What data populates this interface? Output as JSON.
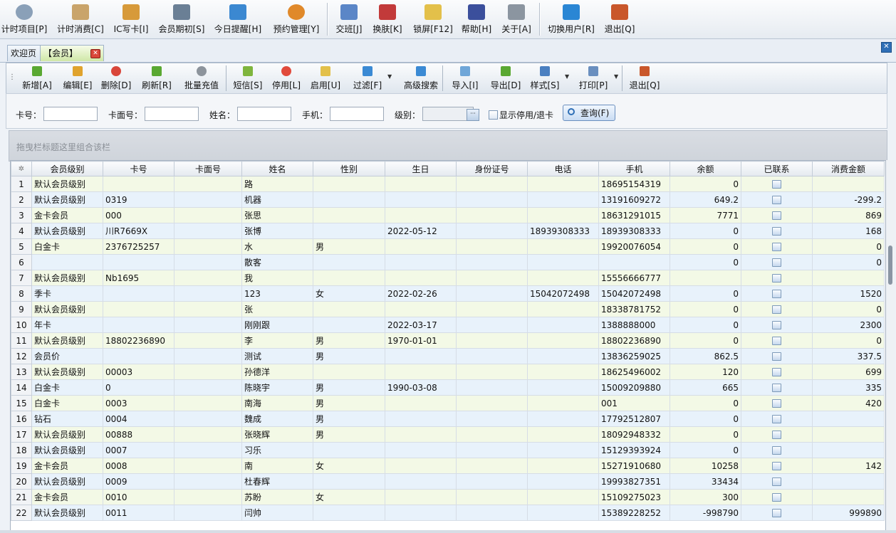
{
  "top_toolbar": [
    {
      "label": "计时项目[P]",
      "icon": "clock-icon",
      "color": "#8aa0b8"
    },
    {
      "label": "计时消费[C]",
      "icon": "hourglass-icon",
      "color": "#c9a46b"
    },
    {
      "label": "IC写卡[I]",
      "icon": "chip-card-icon",
      "color": "#d79a3a"
    },
    {
      "label": "会员期初[S]",
      "icon": "start-doc-icon",
      "color": "#6a7f95"
    },
    {
      "label": "今日提醒[H]",
      "icon": "reminder-icon",
      "color": "#3b88d1"
    },
    {
      "label": "预约管理[Y]",
      "icon": "schedule-icon",
      "color": "#e0892a"
    },
    {
      "label": "交班[J]",
      "icon": "handover-icon",
      "color": "#5b86c7"
    },
    {
      "label": "换肤[K]",
      "icon": "skin-icon",
      "color": "#c23a3a"
    },
    {
      "label": "锁屏[F12]",
      "icon": "lock-icon",
      "color": "#e3c04a"
    },
    {
      "label": "帮助[H]",
      "icon": "help-icon",
      "color": "#3b4f9c"
    },
    {
      "label": "关于[A]",
      "icon": "about-icon",
      "color": "#8b95a0"
    },
    {
      "label": "切换用户[R]",
      "icon": "switch-user-icon",
      "color": "#2a86d4"
    },
    {
      "label": "退出[Q]",
      "icon": "exit-door-icon",
      "color": "#c9572b"
    }
  ],
  "tabs": {
    "welcome": "欢迎页",
    "member": "【会员】"
  },
  "sub_toolbar": [
    {
      "label": "新增[A]",
      "icon": "add-icon",
      "color": "#5aa832"
    },
    {
      "label": "编辑[E]",
      "icon": "edit-icon",
      "color": "#e0a32d"
    },
    {
      "label": "删除[D]",
      "icon": "delete-icon",
      "color": "#d9463a"
    },
    {
      "label": "刷新[R]",
      "icon": "refresh-icon",
      "color": "#5aa832"
    },
    {
      "label": "批量充值",
      "icon": "recharge-icon",
      "color": "#8d949c"
    },
    {
      "label": "短信[S]",
      "icon": "sms-icon",
      "color": "#7fb53d"
    },
    {
      "label": "停用[L]",
      "icon": "disable-icon",
      "color": "#e14a3b"
    },
    {
      "label": "启用[U]",
      "icon": "enable-icon",
      "color": "#e3c04a"
    },
    {
      "label": "过滤[F]",
      "icon": "filter-icon",
      "color": "#3b8ad4"
    },
    {
      "label": "高级搜索",
      "icon": "advanced-search-icon",
      "color": "#3b8ad4"
    },
    {
      "label": "导入[I]",
      "icon": "import-icon",
      "color": "#6fa6d8"
    },
    {
      "label": "导出[D]",
      "icon": "export-icon",
      "color": "#5aa832"
    },
    {
      "label": "样式[S]",
      "icon": "style-icon",
      "color": "#4a7fc0"
    },
    {
      "label": "打印[P]",
      "icon": "print-icon",
      "color": "#6a8fbf"
    },
    {
      "label": "退出[Q]",
      "icon": "exit-icon",
      "color": "#c9572b"
    }
  ],
  "filters": {
    "card_no": "卡号：",
    "card_face": "卡面号：",
    "name": "姓名：",
    "mobile": "手机：",
    "level": "级别：",
    "show_disabled": "显示停用/退卡",
    "query_button": "查询(F)"
  },
  "group_panel": "拖曳栏标题这里组合该栏",
  "table": {
    "columns": [
      "会员级别",
      "卡号",
      "卡面号",
      "姓名",
      "性别",
      "生日",
      "身份证号",
      "电话",
      "手机",
      "余额",
      "已联系",
      "消费金额"
    ],
    "rows": [
      [
        "1",
        "默认会员级别",
        "",
        "",
        "路",
        "",
        "",
        "",
        "",
        "18695154319",
        "0",
        "",
        ""
      ],
      [
        "2",
        "默认会员级别",
        "0319",
        "",
        "机器",
        "",
        "",
        "",
        "",
        "13191609272",
        "649.2",
        "",
        "-299.2"
      ],
      [
        "3",
        "金卡会员",
        "000",
        "",
        "张思",
        "",
        "",
        "",
        "",
        "18631291015",
        "7771",
        "",
        "869"
      ],
      [
        "4",
        "默认会员级别",
        "川R7669X",
        "",
        "张博",
        "",
        "2022-05-12",
        "",
        "18939308333",
        "18939308333",
        "0",
        "",
        "168"
      ],
      [
        "5",
        "白金卡",
        "2376725257",
        "",
        "水",
        "男",
        "",
        "",
        "",
        "19920076054",
        "0",
        "",
        "0"
      ],
      [
        "6",
        "",
        "",
        "",
        "散客",
        "",
        "",
        "",
        "",
        "",
        "0",
        "",
        "0"
      ],
      [
        "7",
        "默认会员级别",
        "Nb1695",
        "",
        "我",
        "",
        "",
        "",
        "",
        "15556666777",
        "",
        "",
        ""
      ],
      [
        "8",
        "季卡",
        "",
        "",
        "123",
        "女",
        "2022-02-26",
        "",
        "15042072498",
        "15042072498",
        "0",
        "",
        "1520"
      ],
      [
        "9",
        "默认会员级别",
        "",
        "",
        "张",
        "",
        "",
        "",
        "",
        "18338781752",
        "0",
        "",
        "0"
      ],
      [
        "10",
        "年卡",
        "",
        "",
        "刚刚跟",
        "",
        "2022-03-17",
        "",
        "",
        "1388888000",
        "0",
        "",
        "2300"
      ],
      [
        "11",
        "默认会员级别",
        "18802236890",
        "",
        "李",
        "男",
        "1970-01-01",
        "",
        "",
        "18802236890",
        "0",
        "",
        "0"
      ],
      [
        "12",
        "会员价",
        "",
        "",
        "测试",
        "男",
        "",
        "",
        "",
        "13836259025",
        "862.5",
        "",
        "337.5"
      ],
      [
        "13",
        "默认会员级别",
        "00003",
        "",
        "孙德洋",
        "",
        "",
        "",
        "",
        "18625496002",
        "120",
        "",
        "699"
      ],
      [
        "14",
        "白金卡",
        "0",
        "",
        "陈晓宇",
        "男",
        "1990-03-08",
        "",
        "",
        "15009209880",
        "665",
        "",
        "335"
      ],
      [
        "15",
        "白金卡",
        "0003",
        "",
        "南海",
        "男",
        "",
        "",
        "",
        "001",
        "0",
        "",
        "420"
      ],
      [
        "16",
        "钻石",
        "0004",
        "",
        "魏成",
        "男",
        "",
        "",
        "",
        "17792512807",
        "0",
        "",
        ""
      ],
      [
        "17",
        "默认会员级别",
        "00888",
        "",
        "张晓辉",
        "男",
        "",
        "",
        "",
        "18092948332",
        "0",
        "",
        ""
      ],
      [
        "18",
        "默认会员级别",
        "0007",
        "",
        "习乐",
        "",
        "",
        "",
        "",
        "15129393924",
        "0",
        "",
        ""
      ],
      [
        "19",
        "金卡会员",
        "0008",
        "",
        "南",
        "女",
        "",
        "",
        "",
        "15271910680",
        "10258",
        "",
        "142"
      ],
      [
        "20",
        "默认会员级别",
        "0009",
        "",
        "杜春辉",
        "",
        "",
        "",
        "",
        "19993827351",
        "33434",
        "",
        ""
      ],
      [
        "21",
        "金卡会员",
        "0010",
        "",
        "苏盼",
        "女",
        "",
        "",
        "",
        "15109275023",
        "300",
        "",
        ""
      ],
      [
        "22",
        "默认会员级别",
        "0011",
        "",
        "闫帅",
        "",
        "",
        "",
        "",
        "15389228252",
        "-998790",
        "",
        "999890"
      ]
    ]
  }
}
